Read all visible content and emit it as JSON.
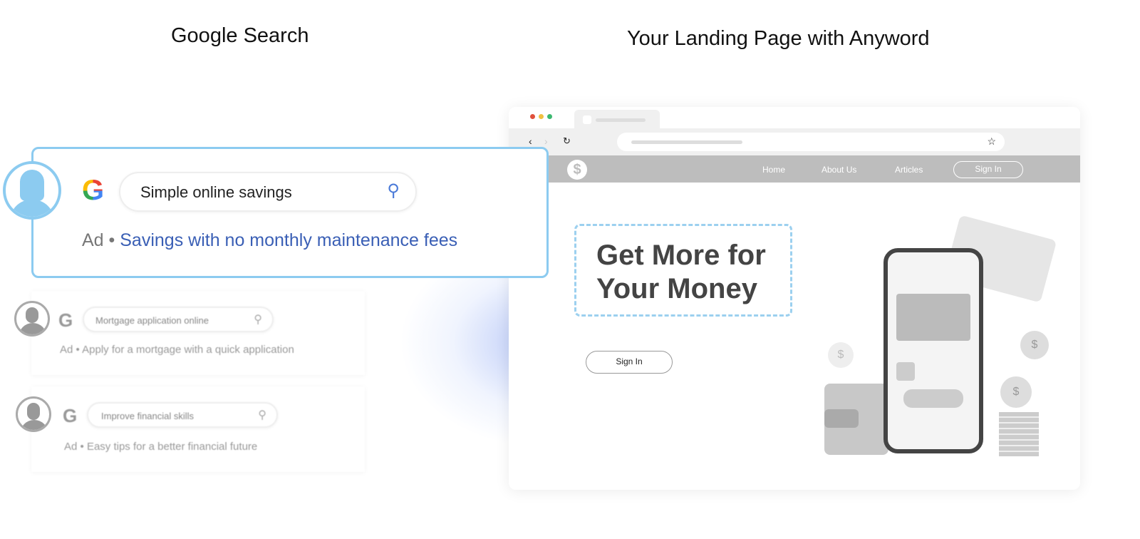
{
  "left": {
    "heading": "Google Search",
    "main": {
      "query": "Simple online savings",
      "ad_label": "Ad",
      "ad_text": "Savings with no monthly maintenance fees"
    },
    "results": [
      {
        "query": "Mortgage application online",
        "ad_label": "Ad",
        "ad_text": "Apply for a mortgage with a quick application"
      },
      {
        "query": "Improve financial skills",
        "ad_label": "Ad",
        "ad_text": "Easy tips for a better financial future"
      }
    ]
  },
  "right": {
    "heading": "Your Landing Page with Anyword",
    "nav": {
      "home": "Home",
      "about": "About Us",
      "articles": "Articles",
      "sign_in": "Sign In"
    },
    "hero": {
      "line1": "Get More for",
      "line2": "Your Money"
    },
    "sign_in_button": "Sign In"
  },
  "colors": {
    "accent_blue": "#8ccbf0",
    "ad_link": "#3a5fb5",
    "nav_bar": "#bdbdbd"
  }
}
